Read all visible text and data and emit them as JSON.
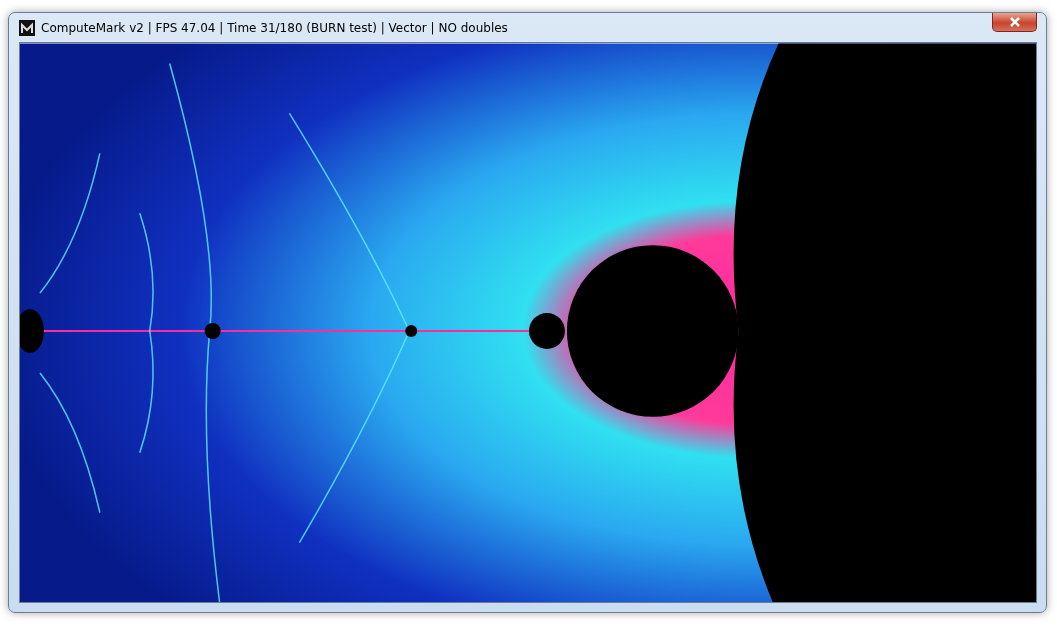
{
  "window": {
    "title": "ComputeMark v2 | FPS 47.04 | Time 31/180 (BURN test) | Vector | NO doubles"
  }
}
